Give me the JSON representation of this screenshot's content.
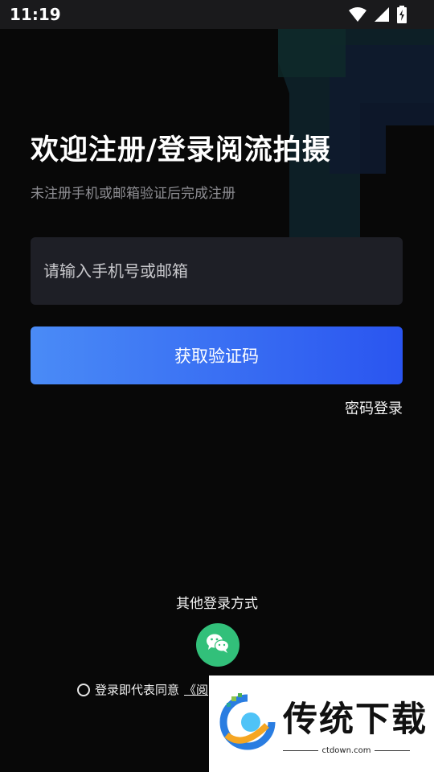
{
  "status_bar": {
    "time": "11:19",
    "icons": [
      "wifi-icon",
      "signal-icon",
      "battery-charging-icon"
    ]
  },
  "login": {
    "title": "欢迎注册/登录阅流拍摄",
    "subtitle": "未注册手机或邮箱验证后完成注册",
    "input_placeholder": "请输入手机号或邮箱",
    "primary_button": "获取验证码",
    "password_login_link": "密码登录",
    "other_methods_title": "其他登录方式",
    "agreement_prefix": "登录即代表同意",
    "agreement_link": "《阅"
  },
  "watermark": {
    "brand": "传统下载",
    "url": "ctdown.com"
  },
  "colors": {
    "background": "#080808",
    "input_bg": "#1e1f26",
    "button_start": "#4a8bf6",
    "button_end": "#2a55f0",
    "wechat": "#32c07a"
  }
}
